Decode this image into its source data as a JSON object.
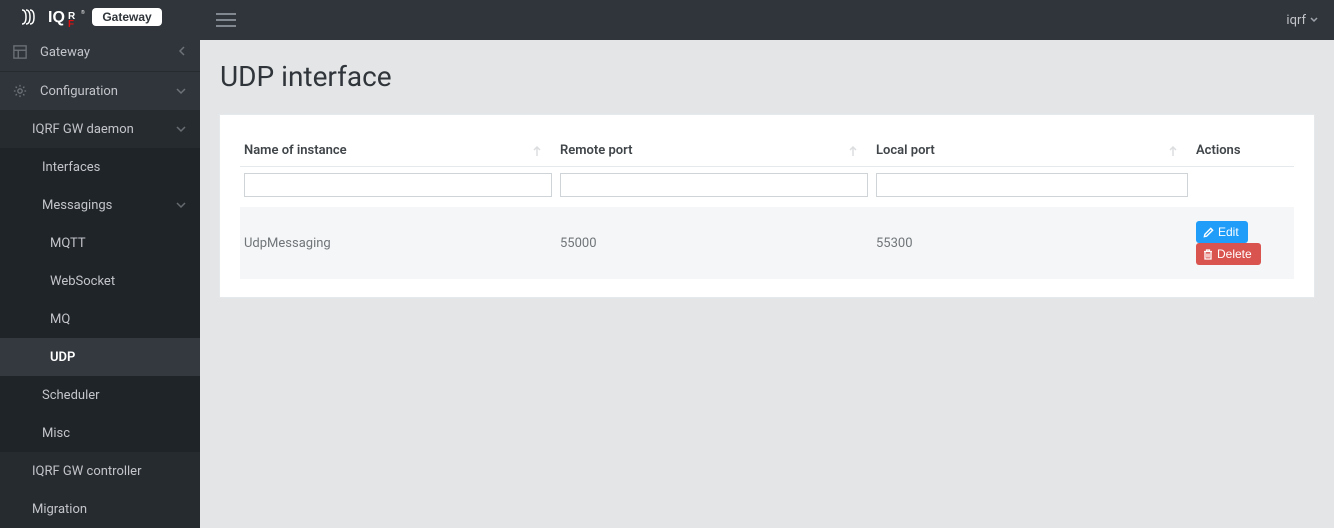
{
  "brand": {
    "left": "IQRF",
    "badge": "Gateway"
  },
  "topbar": {
    "user": "iqrf"
  },
  "sidebar": {
    "items": [
      {
        "label": "Gateway"
      },
      {
        "label": "Configuration"
      },
      {
        "label": "IQRF GW daemon"
      },
      {
        "label": "Interfaces"
      },
      {
        "label": "Messagings"
      },
      {
        "label": "MQTT"
      },
      {
        "label": "WebSocket"
      },
      {
        "label": "MQ"
      },
      {
        "label": "UDP"
      },
      {
        "label": "Scheduler"
      },
      {
        "label": "Misc"
      },
      {
        "label": "IQRF GW controller"
      },
      {
        "label": "Migration"
      }
    ]
  },
  "page": {
    "title": "UDP interface"
  },
  "table": {
    "columns": {
      "name": "Name of instance",
      "remote": "Remote port",
      "local": "Local port",
      "actions": "Actions"
    },
    "rows": [
      {
        "name": "UdpMessaging",
        "remote": "55000",
        "local": "55300"
      }
    ]
  },
  "buttons": {
    "edit": "Edit",
    "delete": "Delete"
  }
}
